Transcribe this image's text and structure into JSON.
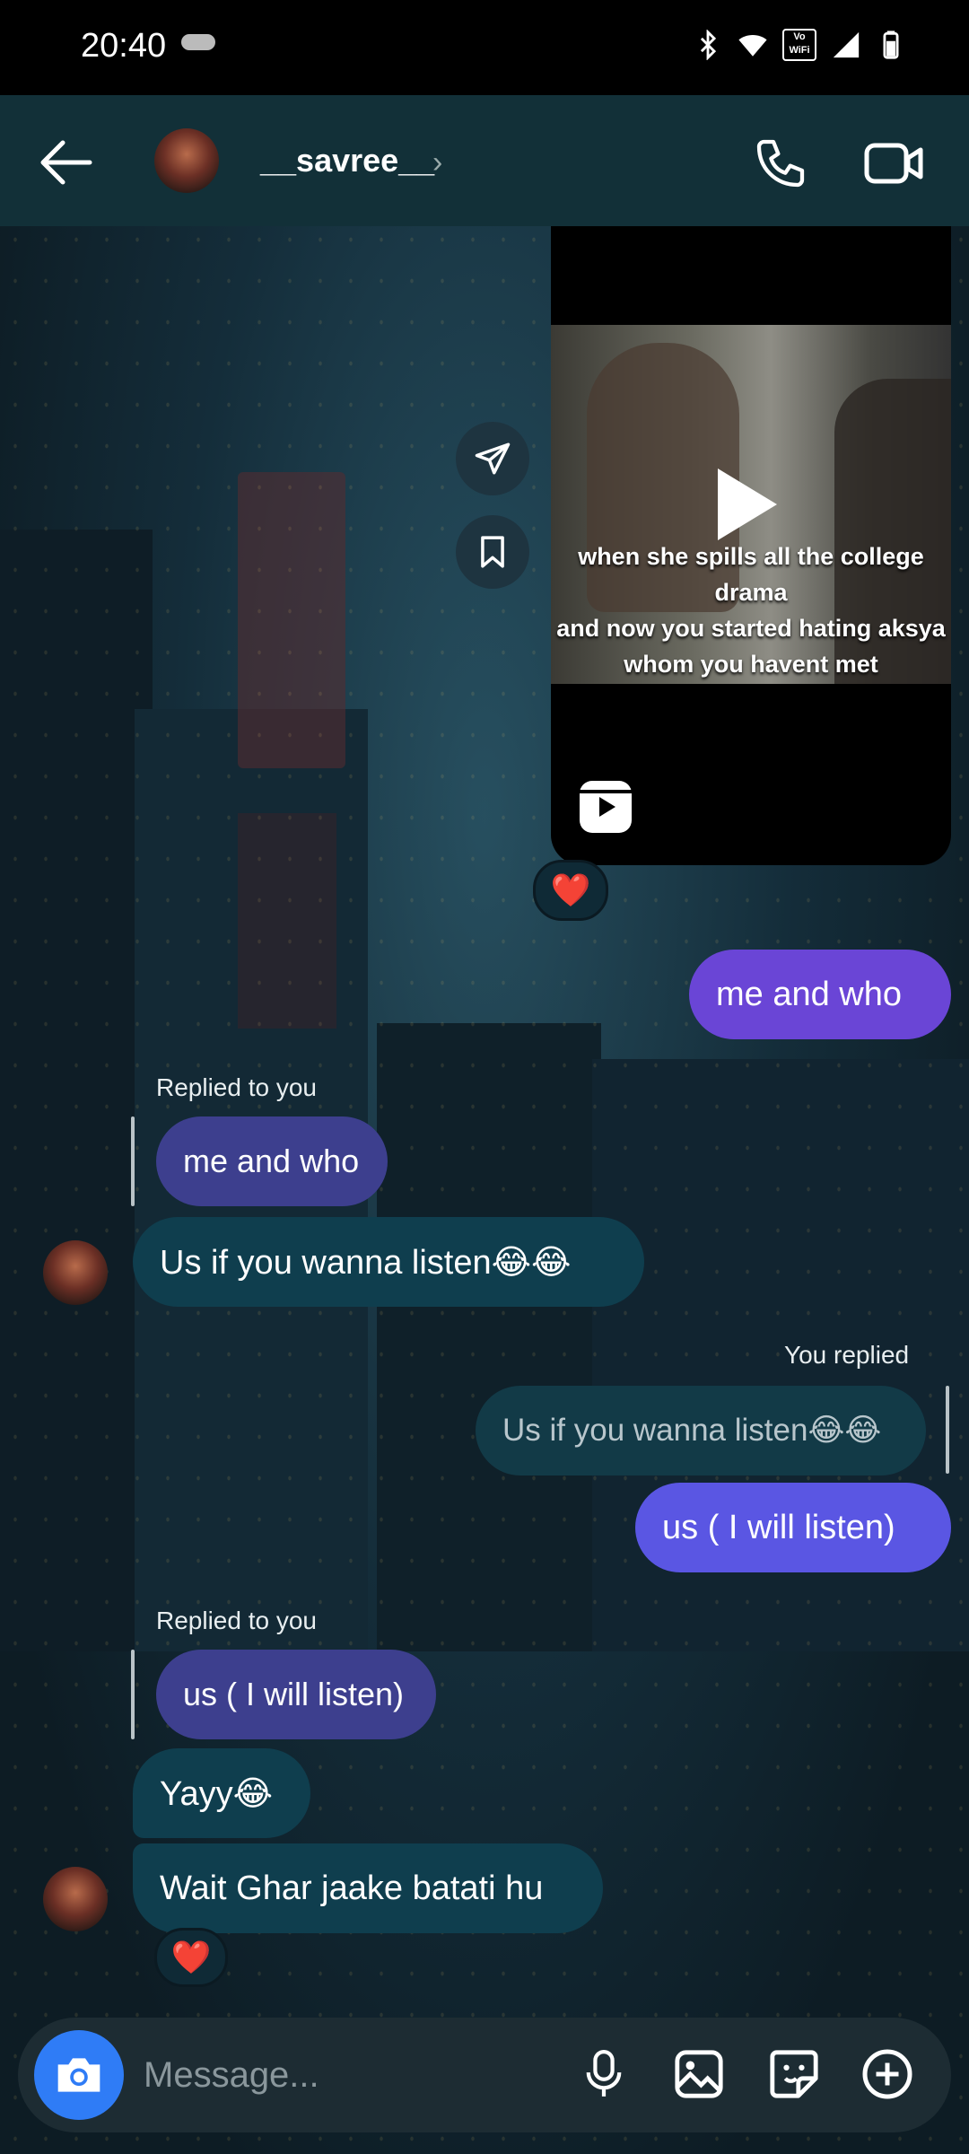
{
  "status_bar": {
    "time": "20:40",
    "network_badge": "Vo WiFi"
  },
  "header": {
    "username": "__savree__"
  },
  "reel": {
    "caption_lines": [
      "when she spills all the college drama",
      "and now you started hating aksya",
      "whom you havent met"
    ],
    "reaction": "❤️"
  },
  "messages": {
    "m1": "me and who",
    "m2_label": "Replied to you",
    "m2_quote": "me and who",
    "m3": "Us if you wanna listen😂😂",
    "m4_label": "You replied",
    "m4_quote": "Us if you wanna listen😂😂",
    "m5": "us ( I will listen)",
    "m6_label": "Replied to you",
    "m6_quote": "us ( I will listen)",
    "m7": "Yayy😂",
    "m8": "Wait Ghar jaake batati hu",
    "m8_reaction": "❤️"
  },
  "composer": {
    "placeholder": "Message..."
  },
  "colors": {
    "sent": "#6a45d6",
    "received": "#0f3e4e",
    "camera": "#2f7cf6"
  }
}
